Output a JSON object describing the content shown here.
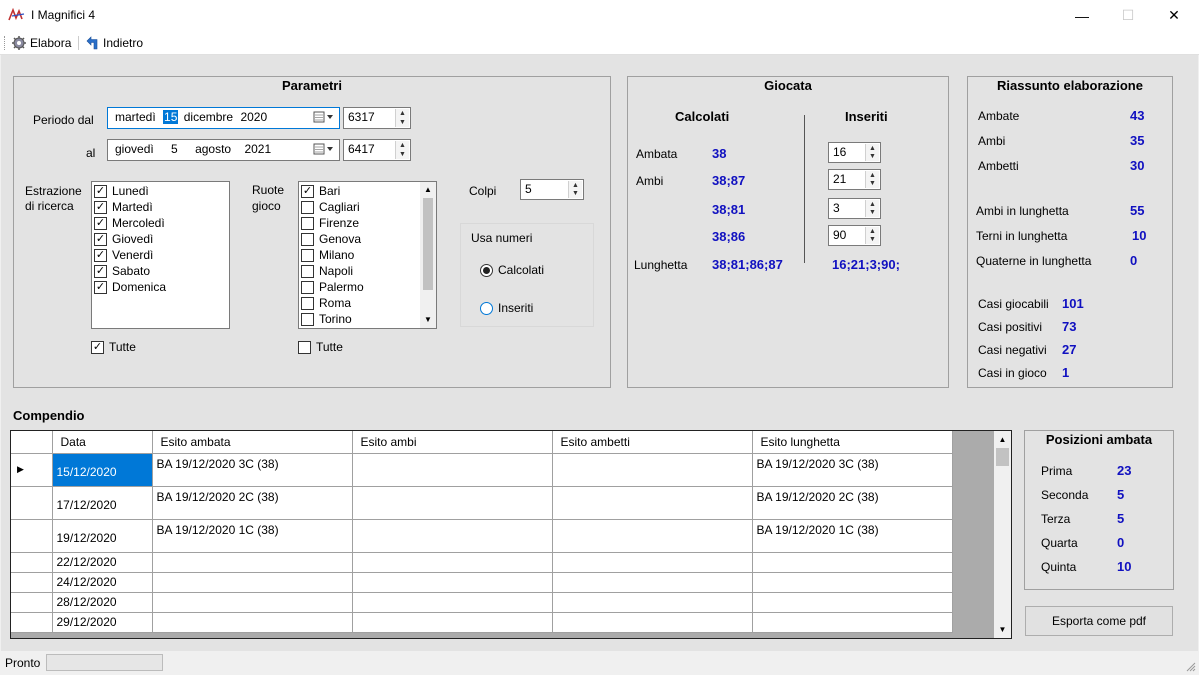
{
  "window": {
    "title": "I Magnifici 4",
    "min_glyph": "—",
    "max_glyph": "☐",
    "close_glyph": "✕"
  },
  "toolbar": {
    "elabora": "Elabora",
    "indietro": "Indietro"
  },
  "parametri": {
    "title": "Parametri",
    "periodo_dal_label": "Periodo dal",
    "al_label": "al",
    "dal": {
      "weekday": "martedì",
      "day": "15",
      "month": "dicembre",
      "year": "2020",
      "num": "6317"
    },
    "al": {
      "weekday": "giovedì",
      "day": "5",
      "month": "agosto",
      "year": "2021",
      "num": "6417"
    },
    "estrazione_label_1": "Estrazione",
    "estrazione_label_2": "di ricerca",
    "giorni": [
      "Lunedì",
      "Martedì",
      "Mercoledì",
      "Giovedì",
      "Venerdì",
      "Sabato",
      "Domenica"
    ],
    "giorni_tutte": "Tutte",
    "ruote_label_1": "Ruote",
    "ruote_label_2": "gioco",
    "ruote": [
      "Bari",
      "Cagliari",
      "Firenze",
      "Genova",
      "Milano",
      "Napoli",
      "Palermo",
      "Roma",
      "Torino"
    ],
    "ruote_tutte": "Tutte",
    "colpi_label": "Colpi",
    "colpi_value": "5",
    "usa_numeri_label": "Usa numeri",
    "radio_calcolati": "Calcolati",
    "radio_inseriti": "Inseriti"
  },
  "giocata": {
    "title": "Giocata",
    "calcolati_header": "Calcolati",
    "inseriti_header": "Inseriti",
    "ambata_label": "Ambata",
    "ambi_label": "Ambi",
    "lunghetta_label": "Lunghetta",
    "calc_ambata": "38",
    "calc_ambi": [
      "38;87",
      "38;81",
      "38;86"
    ],
    "calc_lunghetta": "38;81;86;87",
    "ins_fields": [
      "16",
      "21",
      "3",
      "90"
    ],
    "ins_lunghetta": "16;21;3;90;"
  },
  "riassunto": {
    "title": "Riassunto elaborazione",
    "rows1": [
      {
        "label": "Ambate",
        "value": "43"
      },
      {
        "label": "Ambi",
        "value": "35"
      },
      {
        "label": "Ambetti",
        "value": "30"
      }
    ],
    "rows2": [
      {
        "label": "Ambi in lunghetta",
        "value": "55"
      },
      {
        "label": "Terni in lunghetta",
        "value": "10"
      },
      {
        "label": "Quaterne in lunghetta",
        "value": "0"
      }
    ],
    "rows3": [
      {
        "label": "Casi giocabili",
        "value": "101"
      },
      {
        "label": "Casi positivi",
        "value": "73"
      },
      {
        "label": "Casi negativi",
        "value": "27"
      },
      {
        "label": "Casi in gioco",
        "value": "1"
      }
    ]
  },
  "compendio": {
    "title": "Compendio",
    "columns": [
      "Data",
      "Esito ambata",
      "Esito ambi",
      "Esito ambetti",
      "Esito lunghetta"
    ],
    "rows": [
      {
        "data": "15/12/2020",
        "ambata": "BA  19/12/2020  3C (38)",
        "ambi": "",
        "ambetti": "",
        "lunghetta": "BA  19/12/2020  3C (38)"
      },
      {
        "data": "17/12/2020",
        "ambata": "BA  19/12/2020  2C (38)",
        "ambi": "",
        "ambetti": "",
        "lunghetta": "BA  19/12/2020  2C (38)"
      },
      {
        "data": "19/12/2020",
        "ambata": "BA  19/12/2020  1C (38)",
        "ambi": "",
        "ambetti": "",
        "lunghetta": "BA  19/12/2020  1C (38)"
      },
      {
        "data": "22/12/2020",
        "ambata": "",
        "ambi": "",
        "ambetti": "",
        "lunghetta": ""
      },
      {
        "data": "24/12/2020",
        "ambata": "",
        "ambi": "",
        "ambetti": "",
        "lunghetta": ""
      },
      {
        "data": "28/12/2020",
        "ambata": "",
        "ambi": "",
        "ambetti": "",
        "lunghetta": ""
      },
      {
        "data": "29/12/2020",
        "ambata": "",
        "ambi": "",
        "ambetti": "",
        "lunghetta": ""
      }
    ]
  },
  "posizioni": {
    "title": "Posizioni ambata",
    "rows": [
      {
        "label": "Prima",
        "value": "23"
      },
      {
        "label": "Seconda",
        "value": "5"
      },
      {
        "label": "Terza",
        "value": "5"
      },
      {
        "label": "Quarta",
        "value": "0"
      },
      {
        "label": "Quinta",
        "value": "10"
      }
    ]
  },
  "esporta_button": "Esporta come pdf",
  "status": {
    "text": "Pronto"
  },
  "colors": {
    "accent": "#0078d7",
    "value_blue": "#1010c0",
    "selected_cell": "#0078d7"
  }
}
